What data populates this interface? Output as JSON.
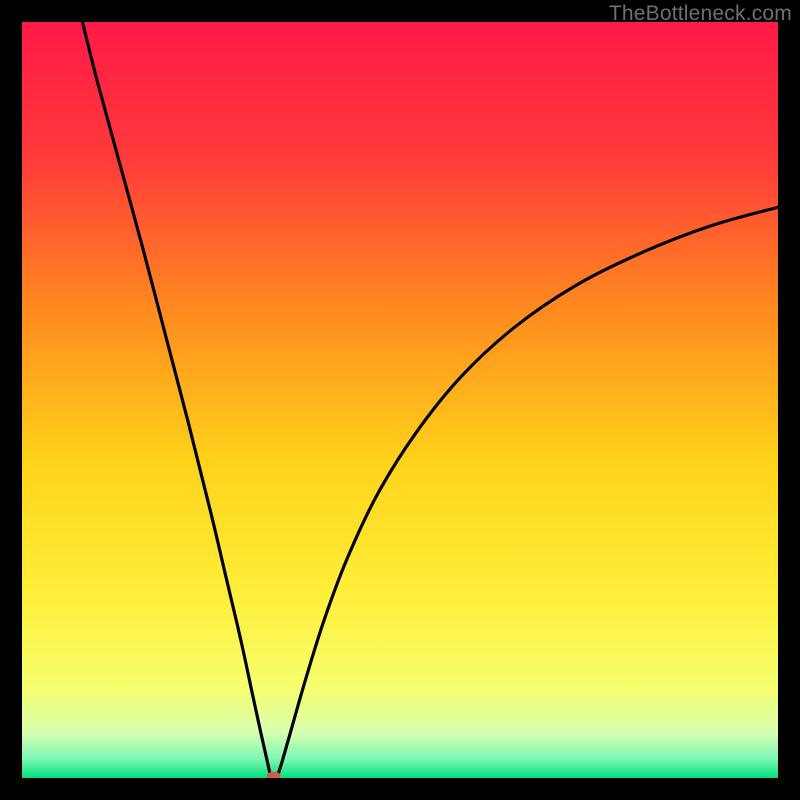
{
  "watermark": "TheBottleneck.com",
  "chart_data": {
    "type": "line",
    "title": "",
    "xlabel": "",
    "ylabel": "",
    "xlim": [
      0,
      100
    ],
    "ylim": [
      0,
      100
    ],
    "grid": false,
    "legend": false,
    "background_gradient": {
      "stops": [
        {
          "offset": 0.0,
          "color": "#ff1a47"
        },
        {
          "offset": 0.18,
          "color": "#ff3a3a"
        },
        {
          "offset": 0.38,
          "color": "#ff8a1f"
        },
        {
          "offset": 0.58,
          "color": "#ffd21a"
        },
        {
          "offset": 0.76,
          "color": "#ffef3b"
        },
        {
          "offset": 0.88,
          "color": "#f6ff6e"
        },
        {
          "offset": 0.94,
          "color": "#d8ffb0"
        },
        {
          "offset": 0.975,
          "color": "#7cf7b4"
        },
        {
          "offset": 1.0,
          "color": "#00e07a"
        }
      ]
    },
    "curve": {
      "description": "V-shaped bottleneck curve with sharp minimum; left branch steep from top-left, right branch rises toward upper-right.",
      "min_x": 33,
      "min_y": 0,
      "points": [
        {
          "x": 8.0,
          "y": 100.0
        },
        {
          "x": 10.0,
          "y": 92.0
        },
        {
          "x": 13.0,
          "y": 81.0
        },
        {
          "x": 16.0,
          "y": 70.0
        },
        {
          "x": 19.0,
          "y": 58.5
        },
        {
          "x": 22.0,
          "y": 47.0
        },
        {
          "x": 25.0,
          "y": 35.0
        },
        {
          "x": 27.0,
          "y": 26.5
        },
        {
          "x": 29.0,
          "y": 18.0
        },
        {
          "x": 30.5,
          "y": 11.0
        },
        {
          "x": 31.7,
          "y": 5.5
        },
        {
          "x": 32.6,
          "y": 1.5
        },
        {
          "x": 33.0,
          "y": 0.0
        },
        {
          "x": 33.6,
          "y": 0.0
        },
        {
          "x": 34.2,
          "y": 1.5
        },
        {
          "x": 35.5,
          "y": 6.0
        },
        {
          "x": 37.5,
          "y": 13.0
        },
        {
          "x": 40.0,
          "y": 21.0
        },
        {
          "x": 43.0,
          "y": 29.0
        },
        {
          "x": 47.0,
          "y": 37.5
        },
        {
          "x": 52.0,
          "y": 45.5
        },
        {
          "x": 58.0,
          "y": 53.0
        },
        {
          "x": 65.0,
          "y": 59.5
        },
        {
          "x": 73.0,
          "y": 65.0
        },
        {
          "x": 82.0,
          "y": 69.5
        },
        {
          "x": 91.0,
          "y": 73.0
        },
        {
          "x": 100.0,
          "y": 75.5
        }
      ]
    },
    "marker": {
      "x": 33.3,
      "y": 0.3,
      "rx": 0.9,
      "ry": 0.55,
      "color": "#d05a4a"
    }
  }
}
